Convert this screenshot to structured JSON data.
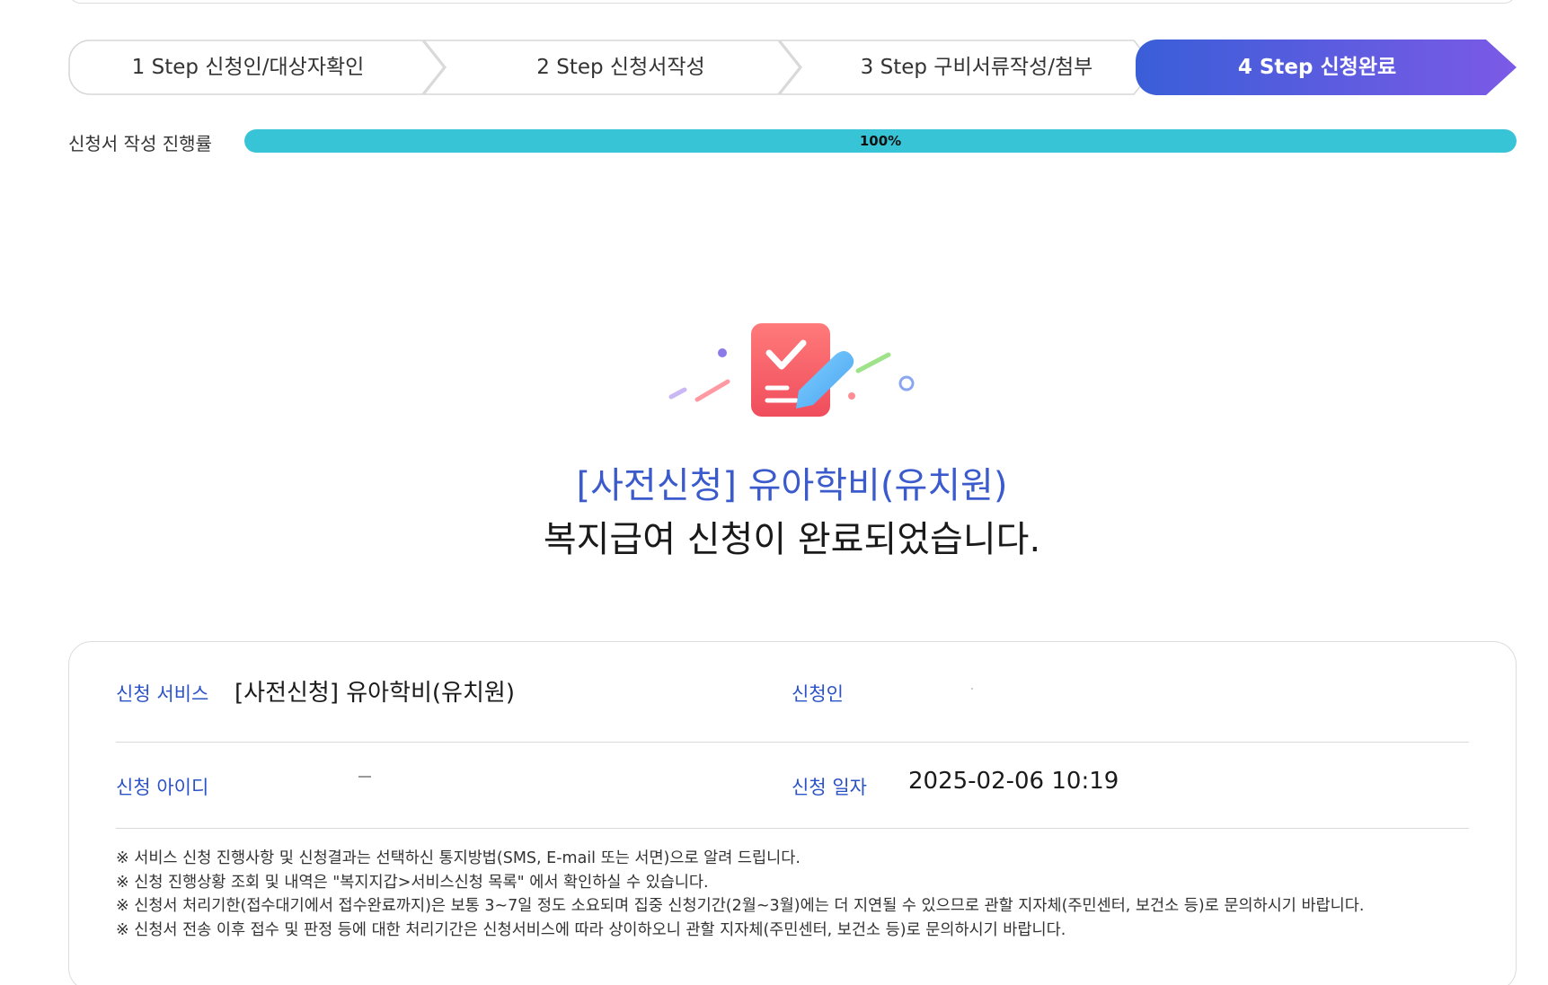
{
  "steps": [
    {
      "label": "1 Step 신청인/대상자확인",
      "active": false
    },
    {
      "label": "2 Step 신청서작성",
      "active": false
    },
    {
      "label": "3 Step 구비서류작성/첨부",
      "active": false
    },
    {
      "label": "4 Step 신청완료",
      "active": true
    }
  ],
  "progress": {
    "label": "신청서 작성 진행률",
    "value": 100,
    "text": "100%"
  },
  "completion": {
    "service_title": "[사전신청] 유아학비(유치원)",
    "message": "복지급여 신청이 완료되었습니다.",
    "icon": "document-check-icon"
  },
  "info": {
    "service_label": "신청 서비스",
    "service_value": "[사전신청] 유아학비(유치원)",
    "applicant_label": "신청인",
    "applicant_value": "",
    "id_label": "신청 아이디",
    "id_value": "",
    "date_label": "신청 일자",
    "date_value": "2025-02-06 10:19"
  },
  "notes": [
    "※ 서비스 신청 진행사항 및 신청결과는 선택하신 통지방법(SMS, E-mail 또는 서면)으로 알려 드립니다.",
    "※ 신청 진행상황 조회 및 내역은 \"복지지갑>서비스신청 목록\" 에서 확인하실 수 있습니다.",
    "※ 신청서 처리기한(접수대기에서 접수완료까지)은 보통 3~7일 정도 소요되며 집중 신청기간(2월~3월)에는 더 지연될 수 있으므로 관할 지자체(주민센터, 보건소 등)로 문의하시기 바랍니다.",
    "※ 신청서 전송 이후 접수 및 판정 등에 대한 처리기간은 신청서비스에 따라 상이하오니 관할 지자체(주민센터, 보건소 등)로 문의하시기 바랍니다."
  ],
  "colors": {
    "accent_blue": "#3b5bcc",
    "active_step_start": "#3a5ed8",
    "active_step_end": "#7b5ae6",
    "progress_fill": "#37c4d6",
    "label_blue": "#2b52c6"
  }
}
